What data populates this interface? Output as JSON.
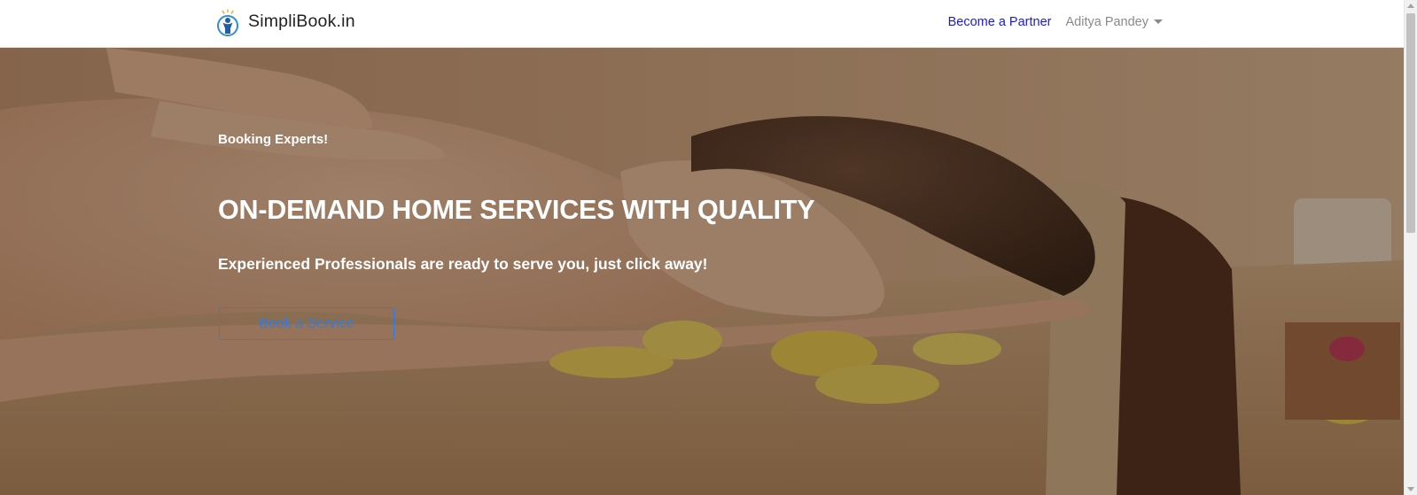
{
  "navbar": {
    "brand_name": "SimpliBook.in",
    "logo_icon": "person-with-sparkle-logo",
    "links": {
      "partner_label": "Become a Partner",
      "user_name": "Aditya Pandey"
    }
  },
  "hero": {
    "tagline": "Booking Experts!",
    "title": "ON-DEMAND HOME SERVICES WITH QUALITY",
    "subtitle": "Experienced Professionals are ready to serve you, just click away!",
    "cta_label": "Book a Service",
    "background": "spa-massage-photo"
  },
  "colors": {
    "partner_link": "#1a1ad6",
    "user_link": "#8a8a8a",
    "cta_accent": "#2f7de0",
    "hero_text": "#ffffff"
  }
}
